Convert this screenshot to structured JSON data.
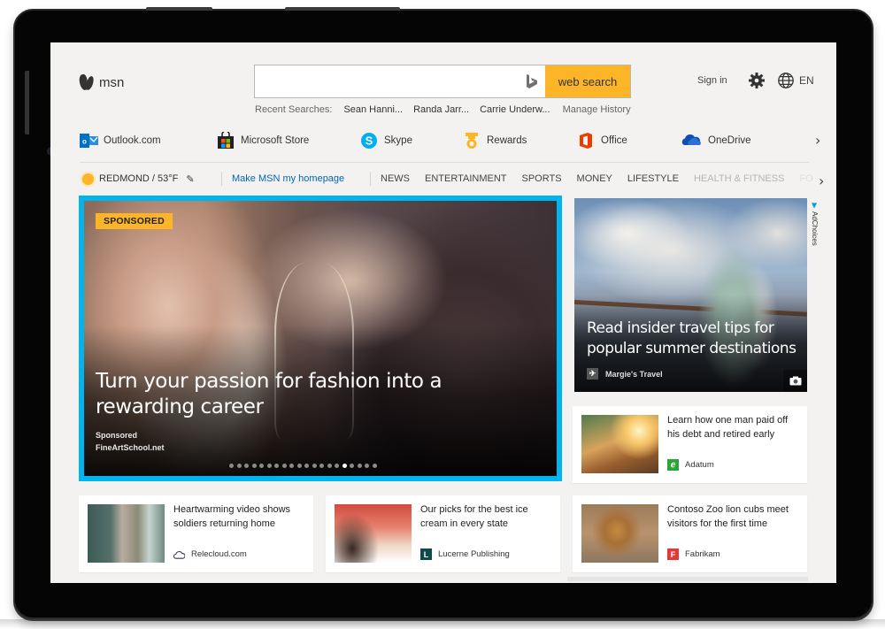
{
  "app": {
    "logo_text": "msn"
  },
  "header": {
    "search_placeholder": "",
    "search_value": "",
    "search_button": "web search",
    "recent_label": "Recent Searches:",
    "recent_items": [
      "Sean Hanni...",
      "Randa Jarr...",
      "Carrie Underw..."
    ],
    "manage_history": "Manage History",
    "sign_in": "Sign in",
    "language": "EN",
    "icons": {
      "settings": "gear-icon",
      "language": "globe-icon",
      "search_engine": "bing-icon"
    }
  },
  "quicklinks": [
    {
      "label": "Outlook.com",
      "icon": "outlook-icon",
      "color": "#0072c6"
    },
    {
      "label": "Microsoft Store",
      "icon": "store-icon",
      "color": "#222222"
    },
    {
      "label": "Skype",
      "icon": "skype-icon",
      "color": "#00aff0"
    },
    {
      "label": "Rewards",
      "icon": "rewards-icon",
      "color": "#fbb526"
    },
    {
      "label": "Office",
      "icon": "office-icon",
      "color": "#eb3c00"
    },
    {
      "label": "OneDrive",
      "icon": "onedrive-icon",
      "color": "#0f4fb0"
    }
  ],
  "navbar": {
    "weather": "REDMOND / 53°F",
    "homepage_link": "Make MSN my homepage",
    "items": [
      "NEWS",
      "ENTERTAINMENT",
      "SPORTS",
      "MONEY",
      "LIFESTYLE",
      "HEALTH & FITNESS",
      "FO"
    ]
  },
  "hero": {
    "badge": "SPONSORED",
    "title": "Turn your passion for fashion into a rewarding career",
    "meta_label": "Sponsored",
    "source": "FineArtSchool.net",
    "carousel_total": 20,
    "carousel_active": 16,
    "accent": "#00b4f0"
  },
  "feature": {
    "title": "Read insider travel tips for popular summer destinations",
    "source": "Margie's Travel",
    "adchoices": "AdChoices"
  },
  "cards": [
    {
      "title": "Learn how one man paid off his debt and retired early",
      "source": "Adatum",
      "logo_color": "#2aa537",
      "logo_char": "a"
    },
    {
      "title": "Heartwarming video shows soldiers returning home",
      "source": "Relecloud.com",
      "logo_color": "#3b2a6b",
      "logo_char": ""
    },
    {
      "title": "Our picks for the best ice cream in every state",
      "source": "Lucerne Publishing",
      "logo_color": "#0f4a48",
      "logo_char": "L"
    },
    {
      "title": "Contoso Zoo lion cubs meet visitors for the first time",
      "source": "Fabrikam",
      "logo_color": "#e23a3a",
      "logo_char": "F"
    }
  ]
}
